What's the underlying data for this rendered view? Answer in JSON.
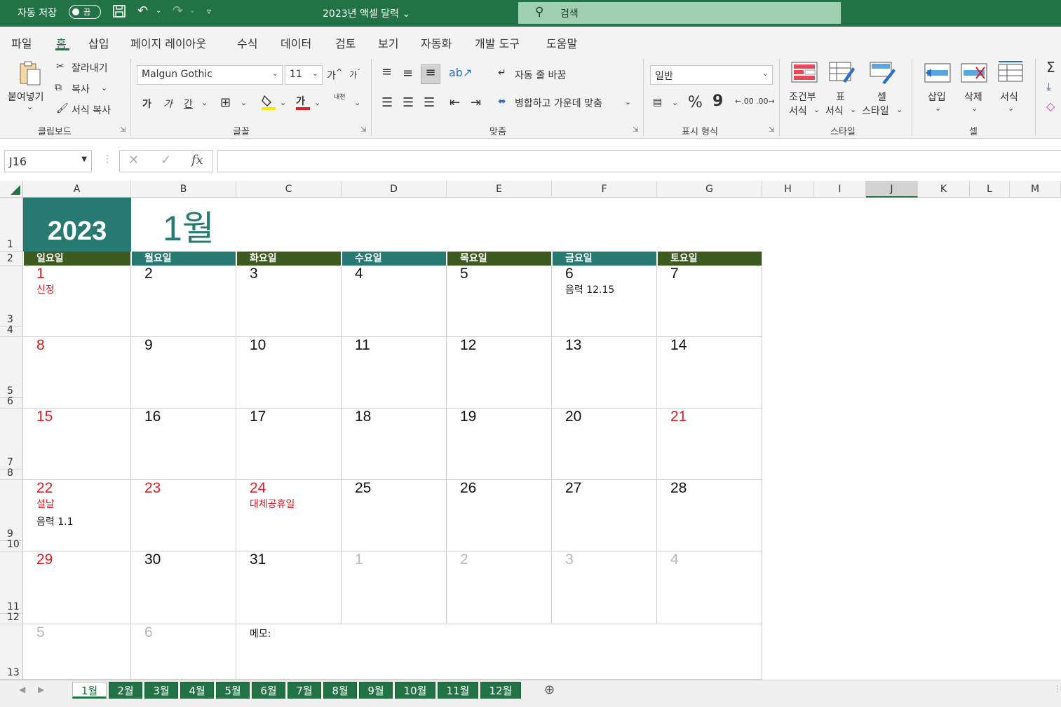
{
  "titlebar": {
    "autosave_label": "자동 저장",
    "autosave_state": "끔",
    "doc_title": "2023년 액셀 달력",
    "search_placeholder": "검색",
    "icons": [
      "save-icon",
      "undo-icon",
      "redo-icon",
      "customize-qat-icon"
    ]
  },
  "menu": {
    "items": [
      "파일",
      "홈",
      "삽입",
      "페이지 레이아웃",
      "수식",
      "데이터",
      "검토",
      "보기",
      "자동화",
      "개발 도구",
      "도움말"
    ],
    "active": "홈"
  },
  "ribbon": {
    "clipboard": {
      "paste": "붙여넣기",
      "cut": "잘라내기",
      "copy": "복사",
      "format_painter": "서식 복사",
      "label": "클립보드"
    },
    "font": {
      "name": "Malgun Gothic",
      "size": "11",
      "grow": "가",
      "shrink": "가",
      "bold": "가",
      "italic": "가",
      "underline": "간",
      "phonetic": "내천",
      "color_letter": "가",
      "label": "글꼴"
    },
    "alignment": {
      "wrap_text": "자동 줄 바꿈",
      "merge_center": "병합하고 가운데 맞춤",
      "label": "맞춤"
    },
    "number": {
      "format": "일반",
      "percent": "%",
      "comma": "9",
      "inc_decimal": ".00",
      "dec_decimal": ".00",
      "label": "표시 형식"
    },
    "styles": {
      "conditional_line1": "조건부",
      "conditional_line2": "서식",
      "table_line1": "표",
      "table_line2": "서식",
      "cell_line1": "셀",
      "cell_line2": "스타일",
      "label": "스타일"
    },
    "cells": {
      "insert": "삽입",
      "delete": "삭제",
      "format": "서식",
      "label": "셀"
    }
  },
  "formula_bar": {
    "name_box": "J16",
    "fx": "fx",
    "cancel": "✕",
    "enter": "✓",
    "formula": ""
  },
  "columns": [
    "A",
    "B",
    "C",
    "D",
    "E",
    "F",
    "G",
    "H",
    "I",
    "J",
    "K",
    "L",
    "M"
  ],
  "selected_column": "J",
  "rows": [
    "1",
    "2",
    "3",
    "4",
    "5",
    "6",
    "7",
    "8",
    "9",
    "10",
    "11",
    "12",
    "13"
  ],
  "calendar": {
    "year": "2023",
    "month": "1월",
    "weekdays": [
      "일요일",
      "월요일",
      "화요일",
      "수요일",
      "목요일",
      "금요일",
      "토요일"
    ],
    "weeks": [
      [
        {
          "day": "1",
          "style": "red",
          "notes": [
            {
              "text": "신정",
              "style": "red"
            }
          ]
        },
        {
          "day": "2",
          "style": "normal",
          "notes": []
        },
        {
          "day": "3",
          "style": "normal",
          "notes": []
        },
        {
          "day": "4",
          "style": "normal",
          "notes": []
        },
        {
          "day": "5",
          "style": "normal",
          "notes": []
        },
        {
          "day": "6",
          "style": "normal",
          "notes": [
            {
              "text": "음력 12.15",
              "style": "normal"
            }
          ]
        },
        {
          "day": "7",
          "style": "normal",
          "notes": []
        }
      ],
      [
        {
          "day": "8",
          "style": "red",
          "notes": []
        },
        {
          "day": "9",
          "style": "normal",
          "notes": []
        },
        {
          "day": "10",
          "style": "normal",
          "notes": []
        },
        {
          "day": "11",
          "style": "normal",
          "notes": []
        },
        {
          "day": "12",
          "style": "normal",
          "notes": []
        },
        {
          "day": "13",
          "style": "normal",
          "notes": []
        },
        {
          "day": "14",
          "style": "normal",
          "notes": []
        }
      ],
      [
        {
          "day": "15",
          "style": "red",
          "notes": []
        },
        {
          "day": "16",
          "style": "normal",
          "notes": []
        },
        {
          "day": "17",
          "style": "normal",
          "notes": []
        },
        {
          "day": "18",
          "style": "normal",
          "notes": []
        },
        {
          "day": "19",
          "style": "normal",
          "notes": []
        },
        {
          "day": "20",
          "style": "normal",
          "notes": []
        },
        {
          "day": "21",
          "style": "red",
          "notes": []
        }
      ],
      [
        {
          "day": "22",
          "style": "red",
          "notes": [
            {
              "text": "설날",
              "style": "red"
            },
            {
              "text": "음력 1.1",
              "style": "normal"
            }
          ]
        },
        {
          "day": "23",
          "style": "red",
          "notes": []
        },
        {
          "day": "24",
          "style": "red",
          "notes": [
            {
              "text": "대체공휴일",
              "style": "red"
            }
          ]
        },
        {
          "day": "25",
          "style": "normal",
          "notes": []
        },
        {
          "day": "26",
          "style": "normal",
          "notes": []
        },
        {
          "day": "27",
          "style": "normal",
          "notes": []
        },
        {
          "day": "28",
          "style": "normal",
          "notes": []
        }
      ],
      [
        {
          "day": "29",
          "style": "red",
          "notes": []
        },
        {
          "day": "30",
          "style": "normal",
          "notes": []
        },
        {
          "day": "31",
          "style": "normal",
          "notes": []
        },
        {
          "day": "1",
          "style": "gray",
          "notes": []
        },
        {
          "day": "2",
          "style": "gray",
          "notes": []
        },
        {
          "day": "3",
          "style": "gray",
          "notes": []
        },
        {
          "day": "4",
          "style": "gray",
          "notes": []
        }
      ],
      [
        {
          "day": "5",
          "style": "gray",
          "notes": []
        },
        {
          "day": "6",
          "style": "gray",
          "notes": []
        }
      ]
    ],
    "memo_label": "메모:"
  },
  "sheet_tabs": [
    "1월",
    "2월",
    "3월",
    "4월",
    "5월",
    "6월",
    "7월",
    "8월",
    "9월",
    "10월",
    "11월",
    "12월"
  ],
  "active_tab": "1월",
  "colors": {
    "brand": "#217346",
    "teal": "#277a72",
    "dark_green": "#3d5a1f",
    "holiday_red": "#e01b24"
  }
}
